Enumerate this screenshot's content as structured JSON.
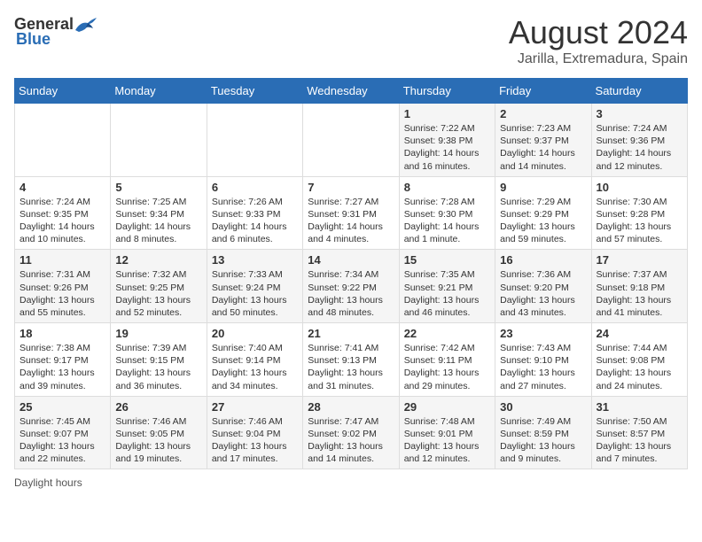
{
  "header": {
    "logo_general": "General",
    "logo_blue": "Blue",
    "month_title": "August 2024",
    "location": "Jarilla, Extremadura, Spain"
  },
  "days_of_week": [
    "Sunday",
    "Monday",
    "Tuesday",
    "Wednesday",
    "Thursday",
    "Friday",
    "Saturday"
  ],
  "footer": {
    "daylight_label": "Daylight hours"
  },
  "weeks": [
    {
      "days": [
        {
          "number": "",
          "sunrise": "",
          "sunset": "",
          "daylight": ""
        },
        {
          "number": "",
          "sunrise": "",
          "sunset": "",
          "daylight": ""
        },
        {
          "number": "",
          "sunrise": "",
          "sunset": "",
          "daylight": ""
        },
        {
          "number": "",
          "sunrise": "",
          "sunset": "",
          "daylight": ""
        },
        {
          "number": "1",
          "sunrise": "7:22 AM",
          "sunset": "9:38 PM",
          "daylight": "14 hours and 16 minutes."
        },
        {
          "number": "2",
          "sunrise": "7:23 AM",
          "sunset": "9:37 PM",
          "daylight": "14 hours and 14 minutes."
        },
        {
          "number": "3",
          "sunrise": "7:24 AM",
          "sunset": "9:36 PM",
          "daylight": "14 hours and 12 minutes."
        }
      ]
    },
    {
      "days": [
        {
          "number": "4",
          "sunrise": "7:24 AM",
          "sunset": "9:35 PM",
          "daylight": "14 hours and 10 minutes."
        },
        {
          "number": "5",
          "sunrise": "7:25 AM",
          "sunset": "9:34 PM",
          "daylight": "14 hours and 8 minutes."
        },
        {
          "number": "6",
          "sunrise": "7:26 AM",
          "sunset": "9:33 PM",
          "daylight": "14 hours and 6 minutes."
        },
        {
          "number": "7",
          "sunrise": "7:27 AM",
          "sunset": "9:31 PM",
          "daylight": "14 hours and 4 minutes."
        },
        {
          "number": "8",
          "sunrise": "7:28 AM",
          "sunset": "9:30 PM",
          "daylight": "14 hours and 1 minute."
        },
        {
          "number": "9",
          "sunrise": "7:29 AM",
          "sunset": "9:29 PM",
          "daylight": "13 hours and 59 minutes."
        },
        {
          "number": "10",
          "sunrise": "7:30 AM",
          "sunset": "9:28 PM",
          "daylight": "13 hours and 57 minutes."
        }
      ]
    },
    {
      "days": [
        {
          "number": "11",
          "sunrise": "7:31 AM",
          "sunset": "9:26 PM",
          "daylight": "13 hours and 55 minutes."
        },
        {
          "number": "12",
          "sunrise": "7:32 AM",
          "sunset": "9:25 PM",
          "daylight": "13 hours and 52 minutes."
        },
        {
          "number": "13",
          "sunrise": "7:33 AM",
          "sunset": "9:24 PM",
          "daylight": "13 hours and 50 minutes."
        },
        {
          "number": "14",
          "sunrise": "7:34 AM",
          "sunset": "9:22 PM",
          "daylight": "13 hours and 48 minutes."
        },
        {
          "number": "15",
          "sunrise": "7:35 AM",
          "sunset": "9:21 PM",
          "daylight": "13 hours and 46 minutes."
        },
        {
          "number": "16",
          "sunrise": "7:36 AM",
          "sunset": "9:20 PM",
          "daylight": "13 hours and 43 minutes."
        },
        {
          "number": "17",
          "sunrise": "7:37 AM",
          "sunset": "9:18 PM",
          "daylight": "13 hours and 41 minutes."
        }
      ]
    },
    {
      "days": [
        {
          "number": "18",
          "sunrise": "7:38 AM",
          "sunset": "9:17 PM",
          "daylight": "13 hours and 39 minutes."
        },
        {
          "number": "19",
          "sunrise": "7:39 AM",
          "sunset": "9:15 PM",
          "daylight": "13 hours and 36 minutes."
        },
        {
          "number": "20",
          "sunrise": "7:40 AM",
          "sunset": "9:14 PM",
          "daylight": "13 hours and 34 minutes."
        },
        {
          "number": "21",
          "sunrise": "7:41 AM",
          "sunset": "9:13 PM",
          "daylight": "13 hours and 31 minutes."
        },
        {
          "number": "22",
          "sunrise": "7:42 AM",
          "sunset": "9:11 PM",
          "daylight": "13 hours and 29 minutes."
        },
        {
          "number": "23",
          "sunrise": "7:43 AM",
          "sunset": "9:10 PM",
          "daylight": "13 hours and 27 minutes."
        },
        {
          "number": "24",
          "sunrise": "7:44 AM",
          "sunset": "9:08 PM",
          "daylight": "13 hours and 24 minutes."
        }
      ]
    },
    {
      "days": [
        {
          "number": "25",
          "sunrise": "7:45 AM",
          "sunset": "9:07 PM",
          "daylight": "13 hours and 22 minutes."
        },
        {
          "number": "26",
          "sunrise": "7:46 AM",
          "sunset": "9:05 PM",
          "daylight": "13 hours and 19 minutes."
        },
        {
          "number": "27",
          "sunrise": "7:46 AM",
          "sunset": "9:04 PM",
          "daylight": "13 hours and 17 minutes."
        },
        {
          "number": "28",
          "sunrise": "7:47 AM",
          "sunset": "9:02 PM",
          "daylight": "13 hours and 14 minutes."
        },
        {
          "number": "29",
          "sunrise": "7:48 AM",
          "sunset": "9:01 PM",
          "daylight": "13 hours and 12 minutes."
        },
        {
          "number": "30",
          "sunrise": "7:49 AM",
          "sunset": "8:59 PM",
          "daylight": "13 hours and 9 minutes."
        },
        {
          "number": "31",
          "sunrise": "7:50 AM",
          "sunset": "8:57 PM",
          "daylight": "13 hours and 7 minutes."
        }
      ]
    }
  ]
}
